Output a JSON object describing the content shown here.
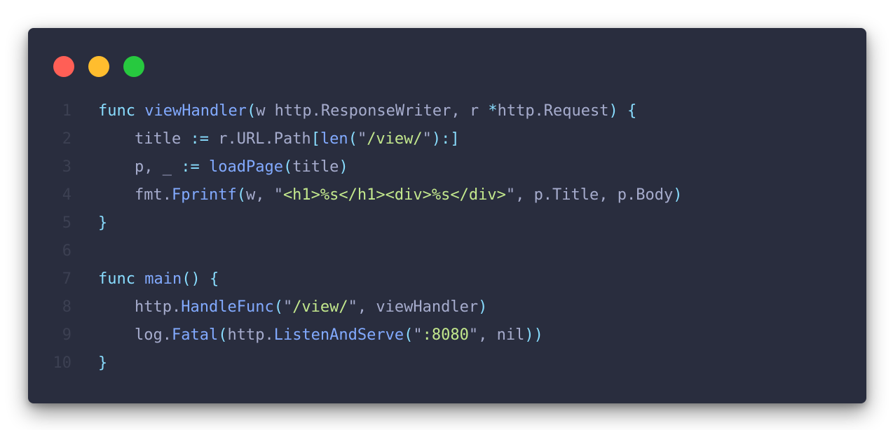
{
  "window": {
    "controls": [
      "close",
      "minimize",
      "maximize"
    ],
    "colors": {
      "background": "#292d3e",
      "close": "#ff5f56",
      "minimize": "#ffbd2e",
      "maximize": "#27c93f",
      "line_number": "#3c4052",
      "keyword": "#c792ea",
      "function": "#82aaff",
      "string": "#c3e88d",
      "operator": "#89ddff",
      "plain": "#a6accd"
    }
  },
  "language": "go",
  "code": {
    "lines": [
      {
        "number": "1",
        "indent": 0,
        "tokens": [
          {
            "t": "func",
            "c": "op"
          },
          {
            "t": " ",
            "c": "pl"
          },
          {
            "t": "viewHandler",
            "c": "fn"
          },
          {
            "t": "(",
            "c": "br"
          },
          {
            "t": "w http.ResponseWriter, r ",
            "c": "pl"
          },
          {
            "t": "*",
            "c": "op"
          },
          {
            "t": "http.Request",
            "c": "pl"
          },
          {
            "t": ") {",
            "c": "br"
          }
        ]
      },
      {
        "number": "2",
        "indent": 1,
        "tokens": [
          {
            "t": "title ",
            "c": "pl"
          },
          {
            "t": ":=",
            "c": "op"
          },
          {
            "t": " r.URL.Path",
            "c": "pl"
          },
          {
            "t": "[",
            "c": "br"
          },
          {
            "t": "len",
            "c": "fn"
          },
          {
            "t": "(",
            "c": "br"
          },
          {
            "t": "\"",
            "c": "pl"
          },
          {
            "t": "/view/",
            "c": "str"
          },
          {
            "t": "\"",
            "c": "pl"
          },
          {
            "t": "):]",
            "c": "br"
          }
        ]
      },
      {
        "number": "3",
        "indent": 1,
        "tokens": [
          {
            "t": "p, _ ",
            "c": "pl"
          },
          {
            "t": ":=",
            "c": "op"
          },
          {
            "t": " ",
            "c": "pl"
          },
          {
            "t": "loadPage",
            "c": "fn"
          },
          {
            "t": "(",
            "c": "br"
          },
          {
            "t": "title",
            "c": "pl"
          },
          {
            "t": ")",
            "c": "br"
          }
        ]
      },
      {
        "number": "4",
        "indent": 1,
        "tokens": [
          {
            "t": "fmt.",
            "c": "pl"
          },
          {
            "t": "Fprintf",
            "c": "fn"
          },
          {
            "t": "(",
            "c": "br"
          },
          {
            "t": "w, \"",
            "c": "pl"
          },
          {
            "t": "<h1>%s</h1><div>%s</div>",
            "c": "str"
          },
          {
            "t": "\", p.Title, p.Body",
            "c": "pl"
          },
          {
            "t": ")",
            "c": "br"
          }
        ]
      },
      {
        "number": "5",
        "indent": 0,
        "tokens": [
          {
            "t": "}",
            "c": "br"
          }
        ]
      },
      {
        "number": "6",
        "indent": 0,
        "tokens": []
      },
      {
        "number": "7",
        "indent": 0,
        "tokens": [
          {
            "t": "func",
            "c": "op"
          },
          {
            "t": " ",
            "c": "pl"
          },
          {
            "t": "main",
            "c": "fn"
          },
          {
            "t": "() {",
            "c": "br"
          }
        ]
      },
      {
        "number": "8",
        "indent": 1,
        "tokens": [
          {
            "t": "http.",
            "c": "pl"
          },
          {
            "t": "HandleFunc",
            "c": "fn"
          },
          {
            "t": "(",
            "c": "br"
          },
          {
            "t": "\"",
            "c": "pl"
          },
          {
            "t": "/view/",
            "c": "str"
          },
          {
            "t": "\", viewHandler",
            "c": "pl"
          },
          {
            "t": ")",
            "c": "br"
          }
        ]
      },
      {
        "number": "9",
        "indent": 1,
        "tokens": [
          {
            "t": "log.",
            "c": "pl"
          },
          {
            "t": "Fatal",
            "c": "fn"
          },
          {
            "t": "(",
            "c": "br"
          },
          {
            "t": "http.",
            "c": "pl"
          },
          {
            "t": "ListenAndServe",
            "c": "fn"
          },
          {
            "t": "(",
            "c": "br"
          },
          {
            "t": "\"",
            "c": "pl"
          },
          {
            "t": ":8080",
            "c": "str"
          },
          {
            "t": "\", nil",
            "c": "pl"
          },
          {
            "t": "))",
            "c": "br"
          }
        ]
      },
      {
        "number": "10",
        "indent": 0,
        "tokens": [
          {
            "t": "}",
            "c": "br"
          }
        ]
      }
    ]
  }
}
